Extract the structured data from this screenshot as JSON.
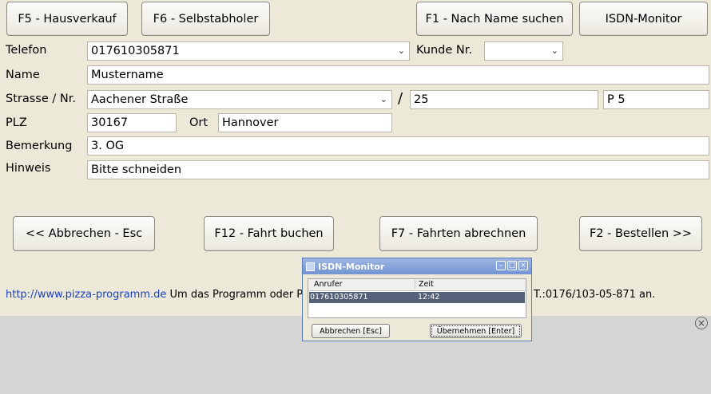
{
  "top_buttons": {
    "hausverkauf": "F5 - Hausverkauf",
    "selbstabholer": "F6 - Selbstabholer",
    "name_suchen": "F1 - Nach Name suchen",
    "isdn_monitor": "ISDN-Monitor"
  },
  "form": {
    "telefon_label": "Telefon",
    "telefon_value": "017610305871",
    "kunde_label": "Kunde Nr.",
    "kunde_value": "",
    "name_label": "Name",
    "name_value": "Mustername",
    "strasse_label": "Strasse / Nr.",
    "strasse_value": "Aachener Straße",
    "slash": "/",
    "hausnr_value": "25",
    "zusatz_value": "P 5",
    "plz_label": "PLZ",
    "plz_value": "30167",
    "ort_label": "Ort",
    "ort_value": "Hannover",
    "bemerkung_label": "Bemerkung",
    "bemerkung_value": "3. OG",
    "hinweis_label": "Hinweis",
    "hinweis_value": "Bitte schneiden"
  },
  "action_buttons": {
    "abbrechen": "<< Abbrechen - Esc",
    "fahrt_buchen": "F12 - Fahrt buchen",
    "fahrten_abrechnen": "F7 - Fahrten abrechnen",
    "bestellen": "F2 - Bestellen >>"
  },
  "footer": {
    "link": "http://www.pizza-programm.de",
    "text_start": "Um das Programm oder Pizz",
    "text_end": "T.:0176/103-05-871 an."
  },
  "dialog": {
    "title": "ISDN-Monitor",
    "col_anrufer": "Anrufer",
    "col_zeit": "Zeit",
    "row_anrufer": "017610305871",
    "row_zeit": "12:42",
    "btn_abbrechen": "Abbrechen [Esc]",
    "btn_uebernehmen": "Übernehmen [Enter]"
  }
}
